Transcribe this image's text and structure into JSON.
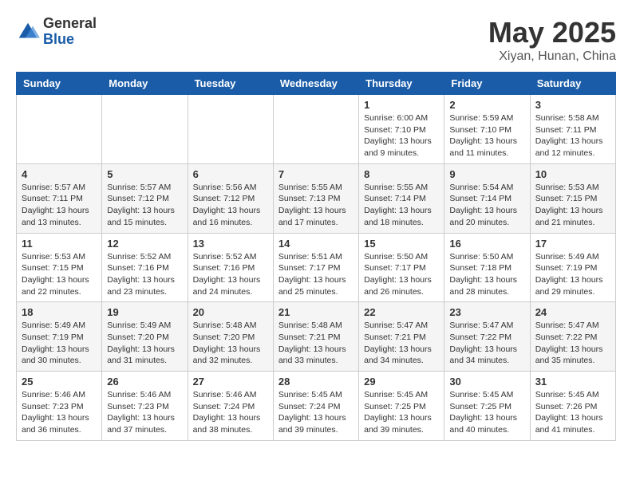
{
  "logo": {
    "general": "General",
    "blue": "Blue"
  },
  "title": "May 2025",
  "location": "Xiyan, Hunan, China",
  "days_of_week": [
    "Sunday",
    "Monday",
    "Tuesday",
    "Wednesday",
    "Thursday",
    "Friday",
    "Saturday"
  ],
  "weeks": [
    [
      {
        "day": "",
        "info": ""
      },
      {
        "day": "",
        "info": ""
      },
      {
        "day": "",
        "info": ""
      },
      {
        "day": "",
        "info": ""
      },
      {
        "day": "1",
        "info": "Sunrise: 6:00 AM\nSunset: 7:10 PM\nDaylight: 13 hours\nand 9 minutes."
      },
      {
        "day": "2",
        "info": "Sunrise: 5:59 AM\nSunset: 7:10 PM\nDaylight: 13 hours\nand 11 minutes."
      },
      {
        "day": "3",
        "info": "Sunrise: 5:58 AM\nSunset: 7:11 PM\nDaylight: 13 hours\nand 12 minutes."
      }
    ],
    [
      {
        "day": "4",
        "info": "Sunrise: 5:57 AM\nSunset: 7:11 PM\nDaylight: 13 hours\nand 13 minutes."
      },
      {
        "day": "5",
        "info": "Sunrise: 5:57 AM\nSunset: 7:12 PM\nDaylight: 13 hours\nand 15 minutes."
      },
      {
        "day": "6",
        "info": "Sunrise: 5:56 AM\nSunset: 7:12 PM\nDaylight: 13 hours\nand 16 minutes."
      },
      {
        "day": "7",
        "info": "Sunrise: 5:55 AM\nSunset: 7:13 PM\nDaylight: 13 hours\nand 17 minutes."
      },
      {
        "day": "8",
        "info": "Sunrise: 5:55 AM\nSunset: 7:14 PM\nDaylight: 13 hours\nand 18 minutes."
      },
      {
        "day": "9",
        "info": "Sunrise: 5:54 AM\nSunset: 7:14 PM\nDaylight: 13 hours\nand 20 minutes."
      },
      {
        "day": "10",
        "info": "Sunrise: 5:53 AM\nSunset: 7:15 PM\nDaylight: 13 hours\nand 21 minutes."
      }
    ],
    [
      {
        "day": "11",
        "info": "Sunrise: 5:53 AM\nSunset: 7:15 PM\nDaylight: 13 hours\nand 22 minutes."
      },
      {
        "day": "12",
        "info": "Sunrise: 5:52 AM\nSunset: 7:16 PM\nDaylight: 13 hours\nand 23 minutes."
      },
      {
        "day": "13",
        "info": "Sunrise: 5:52 AM\nSunset: 7:16 PM\nDaylight: 13 hours\nand 24 minutes."
      },
      {
        "day": "14",
        "info": "Sunrise: 5:51 AM\nSunset: 7:17 PM\nDaylight: 13 hours\nand 25 minutes."
      },
      {
        "day": "15",
        "info": "Sunrise: 5:50 AM\nSunset: 7:17 PM\nDaylight: 13 hours\nand 26 minutes."
      },
      {
        "day": "16",
        "info": "Sunrise: 5:50 AM\nSunset: 7:18 PM\nDaylight: 13 hours\nand 28 minutes."
      },
      {
        "day": "17",
        "info": "Sunrise: 5:49 AM\nSunset: 7:19 PM\nDaylight: 13 hours\nand 29 minutes."
      }
    ],
    [
      {
        "day": "18",
        "info": "Sunrise: 5:49 AM\nSunset: 7:19 PM\nDaylight: 13 hours\nand 30 minutes."
      },
      {
        "day": "19",
        "info": "Sunrise: 5:49 AM\nSunset: 7:20 PM\nDaylight: 13 hours\nand 31 minutes."
      },
      {
        "day": "20",
        "info": "Sunrise: 5:48 AM\nSunset: 7:20 PM\nDaylight: 13 hours\nand 32 minutes."
      },
      {
        "day": "21",
        "info": "Sunrise: 5:48 AM\nSunset: 7:21 PM\nDaylight: 13 hours\nand 33 minutes."
      },
      {
        "day": "22",
        "info": "Sunrise: 5:47 AM\nSunset: 7:21 PM\nDaylight: 13 hours\nand 34 minutes."
      },
      {
        "day": "23",
        "info": "Sunrise: 5:47 AM\nSunset: 7:22 PM\nDaylight: 13 hours\nand 34 minutes."
      },
      {
        "day": "24",
        "info": "Sunrise: 5:47 AM\nSunset: 7:22 PM\nDaylight: 13 hours\nand 35 minutes."
      }
    ],
    [
      {
        "day": "25",
        "info": "Sunrise: 5:46 AM\nSunset: 7:23 PM\nDaylight: 13 hours\nand 36 minutes."
      },
      {
        "day": "26",
        "info": "Sunrise: 5:46 AM\nSunset: 7:23 PM\nDaylight: 13 hours\nand 37 minutes."
      },
      {
        "day": "27",
        "info": "Sunrise: 5:46 AM\nSunset: 7:24 PM\nDaylight: 13 hours\nand 38 minutes."
      },
      {
        "day": "28",
        "info": "Sunrise: 5:45 AM\nSunset: 7:24 PM\nDaylight: 13 hours\nand 39 minutes."
      },
      {
        "day": "29",
        "info": "Sunrise: 5:45 AM\nSunset: 7:25 PM\nDaylight: 13 hours\nand 39 minutes."
      },
      {
        "day": "30",
        "info": "Sunrise: 5:45 AM\nSunset: 7:25 PM\nDaylight: 13 hours\nand 40 minutes."
      },
      {
        "day": "31",
        "info": "Sunrise: 5:45 AM\nSunset: 7:26 PM\nDaylight: 13 hours\nand 41 minutes."
      }
    ]
  ]
}
